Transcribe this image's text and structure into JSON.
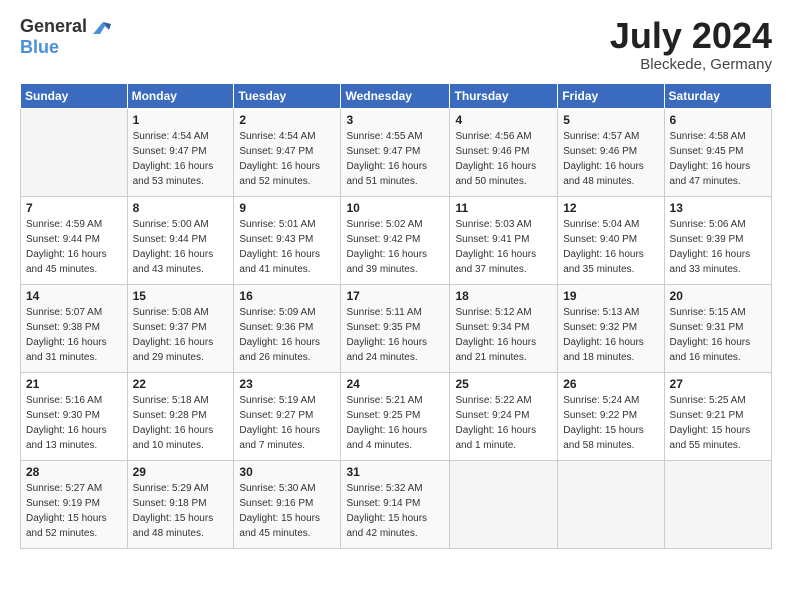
{
  "logo": {
    "general": "General",
    "blue": "Blue"
  },
  "header": {
    "month": "July 2024",
    "location": "Bleckede, Germany"
  },
  "days_of_week": [
    "Sunday",
    "Monday",
    "Tuesday",
    "Wednesday",
    "Thursday",
    "Friday",
    "Saturday"
  ],
  "weeks": [
    [
      {
        "day": "",
        "sunrise": "",
        "sunset": "",
        "daylight": ""
      },
      {
        "day": "1",
        "sunrise": "Sunrise: 4:54 AM",
        "sunset": "Sunset: 9:47 PM",
        "daylight": "Daylight: 16 hours and 53 minutes."
      },
      {
        "day": "2",
        "sunrise": "Sunrise: 4:54 AM",
        "sunset": "Sunset: 9:47 PM",
        "daylight": "Daylight: 16 hours and 52 minutes."
      },
      {
        "day": "3",
        "sunrise": "Sunrise: 4:55 AM",
        "sunset": "Sunset: 9:47 PM",
        "daylight": "Daylight: 16 hours and 51 minutes."
      },
      {
        "day": "4",
        "sunrise": "Sunrise: 4:56 AM",
        "sunset": "Sunset: 9:46 PM",
        "daylight": "Daylight: 16 hours and 50 minutes."
      },
      {
        "day": "5",
        "sunrise": "Sunrise: 4:57 AM",
        "sunset": "Sunset: 9:46 PM",
        "daylight": "Daylight: 16 hours and 48 minutes."
      },
      {
        "day": "6",
        "sunrise": "Sunrise: 4:58 AM",
        "sunset": "Sunset: 9:45 PM",
        "daylight": "Daylight: 16 hours and 47 minutes."
      }
    ],
    [
      {
        "day": "7",
        "sunrise": "Sunrise: 4:59 AM",
        "sunset": "Sunset: 9:44 PM",
        "daylight": "Daylight: 16 hours and 45 minutes."
      },
      {
        "day": "8",
        "sunrise": "Sunrise: 5:00 AM",
        "sunset": "Sunset: 9:44 PM",
        "daylight": "Daylight: 16 hours and 43 minutes."
      },
      {
        "day": "9",
        "sunrise": "Sunrise: 5:01 AM",
        "sunset": "Sunset: 9:43 PM",
        "daylight": "Daylight: 16 hours and 41 minutes."
      },
      {
        "day": "10",
        "sunrise": "Sunrise: 5:02 AM",
        "sunset": "Sunset: 9:42 PM",
        "daylight": "Daylight: 16 hours and 39 minutes."
      },
      {
        "day": "11",
        "sunrise": "Sunrise: 5:03 AM",
        "sunset": "Sunset: 9:41 PM",
        "daylight": "Daylight: 16 hours and 37 minutes."
      },
      {
        "day": "12",
        "sunrise": "Sunrise: 5:04 AM",
        "sunset": "Sunset: 9:40 PM",
        "daylight": "Daylight: 16 hours and 35 minutes."
      },
      {
        "day": "13",
        "sunrise": "Sunrise: 5:06 AM",
        "sunset": "Sunset: 9:39 PM",
        "daylight": "Daylight: 16 hours and 33 minutes."
      }
    ],
    [
      {
        "day": "14",
        "sunrise": "Sunrise: 5:07 AM",
        "sunset": "Sunset: 9:38 PM",
        "daylight": "Daylight: 16 hours and 31 minutes."
      },
      {
        "day": "15",
        "sunrise": "Sunrise: 5:08 AM",
        "sunset": "Sunset: 9:37 PM",
        "daylight": "Daylight: 16 hours and 29 minutes."
      },
      {
        "day": "16",
        "sunrise": "Sunrise: 5:09 AM",
        "sunset": "Sunset: 9:36 PM",
        "daylight": "Daylight: 16 hours and 26 minutes."
      },
      {
        "day": "17",
        "sunrise": "Sunrise: 5:11 AM",
        "sunset": "Sunset: 9:35 PM",
        "daylight": "Daylight: 16 hours and 24 minutes."
      },
      {
        "day": "18",
        "sunrise": "Sunrise: 5:12 AM",
        "sunset": "Sunset: 9:34 PM",
        "daylight": "Daylight: 16 hours and 21 minutes."
      },
      {
        "day": "19",
        "sunrise": "Sunrise: 5:13 AM",
        "sunset": "Sunset: 9:32 PM",
        "daylight": "Daylight: 16 hours and 18 minutes."
      },
      {
        "day": "20",
        "sunrise": "Sunrise: 5:15 AM",
        "sunset": "Sunset: 9:31 PM",
        "daylight": "Daylight: 16 hours and 16 minutes."
      }
    ],
    [
      {
        "day": "21",
        "sunrise": "Sunrise: 5:16 AM",
        "sunset": "Sunset: 9:30 PM",
        "daylight": "Daylight: 16 hours and 13 minutes."
      },
      {
        "day": "22",
        "sunrise": "Sunrise: 5:18 AM",
        "sunset": "Sunset: 9:28 PM",
        "daylight": "Daylight: 16 hours and 10 minutes."
      },
      {
        "day": "23",
        "sunrise": "Sunrise: 5:19 AM",
        "sunset": "Sunset: 9:27 PM",
        "daylight": "Daylight: 16 hours and 7 minutes."
      },
      {
        "day": "24",
        "sunrise": "Sunrise: 5:21 AM",
        "sunset": "Sunset: 9:25 PM",
        "daylight": "Daylight: 16 hours and 4 minutes."
      },
      {
        "day": "25",
        "sunrise": "Sunrise: 5:22 AM",
        "sunset": "Sunset: 9:24 PM",
        "daylight": "Daylight: 16 hours and 1 minute."
      },
      {
        "day": "26",
        "sunrise": "Sunrise: 5:24 AM",
        "sunset": "Sunset: 9:22 PM",
        "daylight": "Daylight: 15 hours and 58 minutes."
      },
      {
        "day": "27",
        "sunrise": "Sunrise: 5:25 AM",
        "sunset": "Sunset: 9:21 PM",
        "daylight": "Daylight: 15 hours and 55 minutes."
      }
    ],
    [
      {
        "day": "28",
        "sunrise": "Sunrise: 5:27 AM",
        "sunset": "Sunset: 9:19 PM",
        "daylight": "Daylight: 15 hours and 52 minutes."
      },
      {
        "day": "29",
        "sunrise": "Sunrise: 5:29 AM",
        "sunset": "Sunset: 9:18 PM",
        "daylight": "Daylight: 15 hours and 48 minutes."
      },
      {
        "day": "30",
        "sunrise": "Sunrise: 5:30 AM",
        "sunset": "Sunset: 9:16 PM",
        "daylight": "Daylight: 15 hours and 45 minutes."
      },
      {
        "day": "31",
        "sunrise": "Sunrise: 5:32 AM",
        "sunset": "Sunset: 9:14 PM",
        "daylight": "Daylight: 15 hours and 42 minutes."
      },
      {
        "day": "",
        "sunrise": "",
        "sunset": "",
        "daylight": ""
      },
      {
        "day": "",
        "sunrise": "",
        "sunset": "",
        "daylight": ""
      },
      {
        "day": "",
        "sunrise": "",
        "sunset": "",
        "daylight": ""
      }
    ]
  ]
}
